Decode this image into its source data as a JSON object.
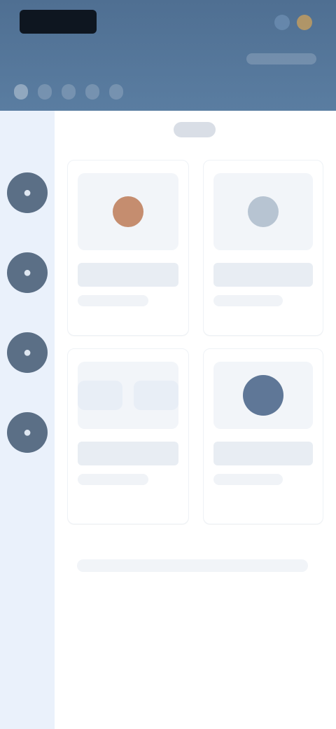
{
  "header": {
    "logo_text": "",
    "tabs": [
      "",
      "",
      "",
      "",
      ""
    ]
  },
  "sidebar": {
    "items": [
      {
        "label": "",
        "icon": "user-icon"
      },
      {
        "label": "",
        "icon": "user-icon"
      },
      {
        "label": "",
        "icon": "user-icon"
      },
      {
        "label": "",
        "icon": "user-icon"
      }
    ]
  },
  "main": {
    "section_title": "",
    "cards": [
      {
        "title": "",
        "meta": ""
      },
      {
        "title": "",
        "meta": ""
      },
      {
        "title": "",
        "meta": ""
      },
      {
        "title": "",
        "meta": ""
      }
    ],
    "footer_text": ""
  },
  "colors": {
    "header": "#5a7da1",
    "sidebar": "#eaf1fb",
    "avatar": "#5b6f86"
  }
}
